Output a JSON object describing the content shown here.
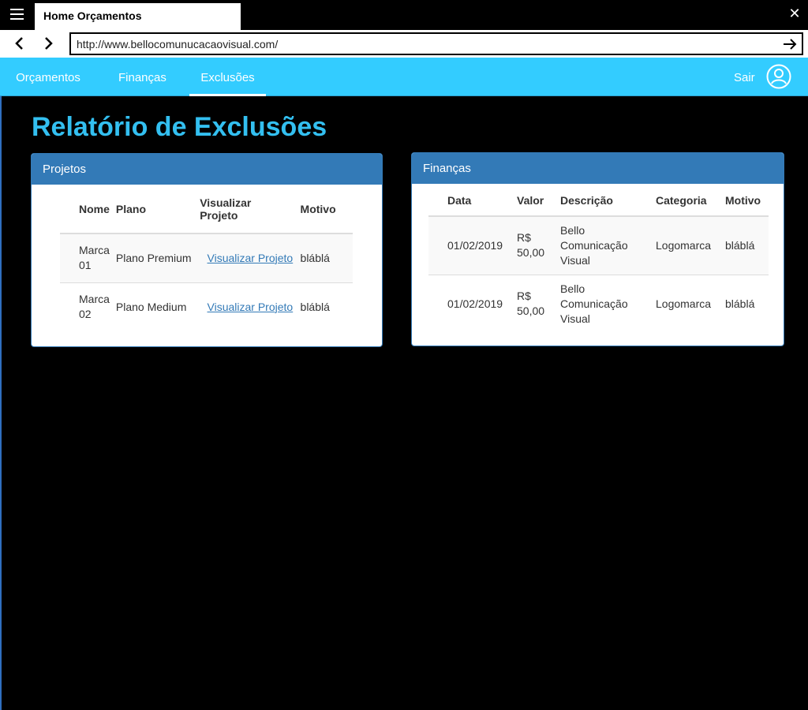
{
  "browser": {
    "tab_title": "Home Orçamentos",
    "url": "http://www.bellocomunucacaovisual.com/"
  },
  "app_nav": {
    "items": [
      {
        "label": "Orçamentos"
      },
      {
        "label": "Finanças"
      },
      {
        "label": "Exclusões"
      }
    ],
    "active": "Exclusões",
    "logout_label": "Sair"
  },
  "page_title": "Relatório de Exclusões",
  "projetos": {
    "heading": "Projetos",
    "columns": [
      "Nome",
      "Plano",
      "Visualizar Projeto",
      "Motivo"
    ],
    "rows": [
      {
        "nome": "Marca 01",
        "plano": "Plano Premium",
        "link": "Visualizar Projeto",
        "motivo": "bláblá"
      },
      {
        "nome": "Marca 02",
        "plano": "Plano Medium",
        "link": "Visualizar Projeto",
        "motivo": "bláblá"
      }
    ]
  },
  "financas": {
    "heading": "Finanças",
    "columns": [
      "Data",
      "Valor",
      "Descrição",
      "Categoria",
      "Motivo"
    ],
    "rows": [
      {
        "data": "01/02/2019",
        "valor": "R$ 50,00",
        "descricao": "Bello Comunicação Visual",
        "categoria": "Logomarca",
        "motivo": "bláblá"
      },
      {
        "data": "01/02/2019",
        "valor": "R$ 50,00",
        "descricao": "Bello Comunicação Visual",
        "categoria": "Logomarca",
        "motivo": "bláblá"
      }
    ]
  },
  "colors": {
    "header_bg": "#33ccff",
    "panel_heading": "#337ab7",
    "title": "#33bff0",
    "link": "#337ab7"
  },
  "icons": [
    "menu-icon",
    "close-icon",
    "back-arrow-icon",
    "forward-arrow-icon",
    "go-arrow-icon",
    "user-icon"
  ]
}
